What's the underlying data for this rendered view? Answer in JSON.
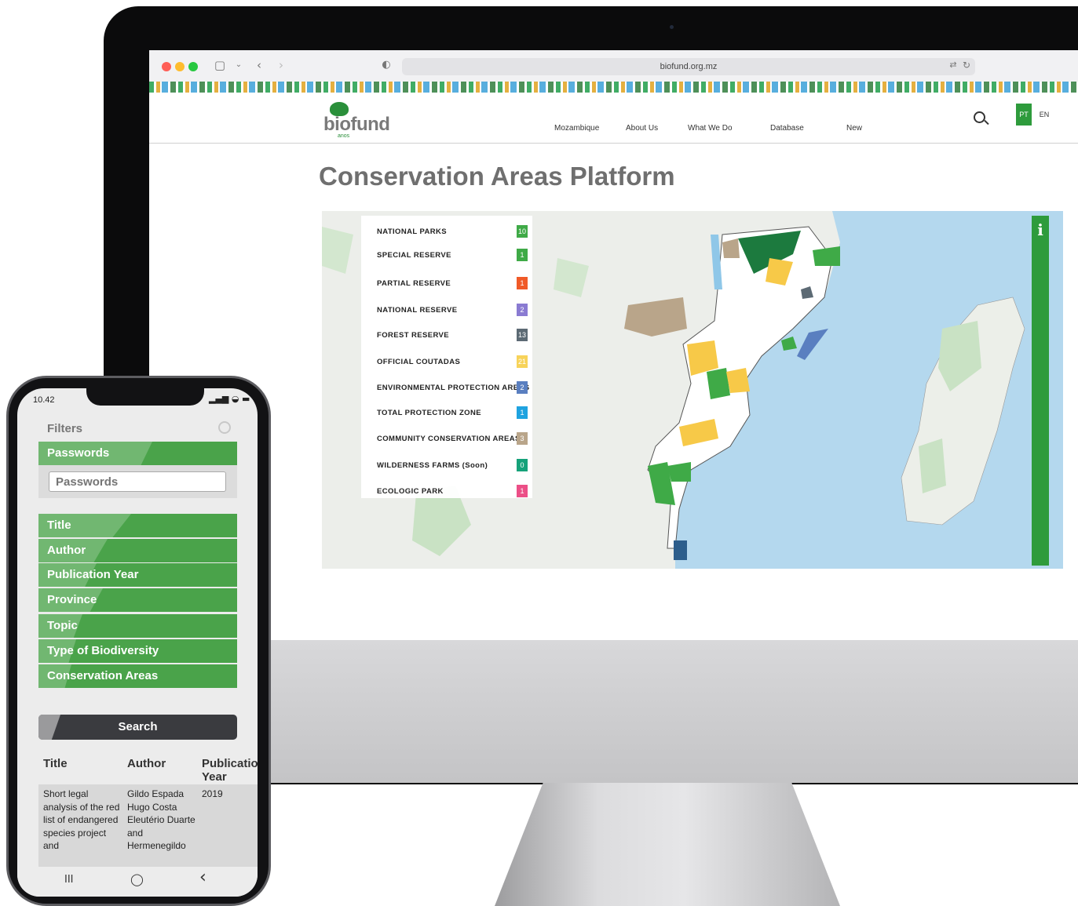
{
  "browser": {
    "url": "biofund.org.mz"
  },
  "site": {
    "logo_text": "biofund",
    "logo_sub": "anos",
    "nav": [
      "Mozambique",
      "About Us",
      "What We Do",
      "Database",
      "New"
    ],
    "lang_pt": "PT",
    "lang_en": "EN"
  },
  "page_title": "Conservation Areas Platform",
  "map": {
    "info_label": "i",
    "legend": [
      {
        "label": "NATIONAL PARKS",
        "count": "10",
        "color": "#3faa47"
      },
      {
        "label": "SPECIAL RESERVE",
        "count": "1",
        "color": "#3faa47"
      },
      {
        "label": "PARTIAL RESERVE",
        "count": "1",
        "color": "#f05a28"
      },
      {
        "label": "NATIONAL RESERVE",
        "count": "2",
        "color": "#8a7bd2"
      },
      {
        "label": "FOREST RESERVE",
        "count": "13",
        "color": "#5c6a74"
      },
      {
        "label": "OFFICIAL COUTADAS",
        "count": "21",
        "color": "#f7d35a"
      },
      {
        "label": "ENVIRONMENTAL PROTECTION AREAS",
        "count": "2",
        "color": "#5a7fc0"
      },
      {
        "label": "TOTAL PROTECTION ZONE",
        "count": "1",
        "color": "#1fa3e0"
      },
      {
        "label": "COMMUNITY CONSERVATION AREAS",
        "count": "3",
        "color": "#b9a58a"
      },
      {
        "label": "WILDERNESS FARMS (Soon)",
        "count": "0",
        "color": "#16a27a"
      },
      {
        "label": "ECOLOGIC PARK",
        "count": "1",
        "color": "#ec4f87"
      }
    ]
  },
  "phone": {
    "time": "10.42",
    "status_icons": "▂▄▆ ◒ ▬",
    "filters_title": "Filters",
    "passwords_label": "Passwords",
    "passwords_placeholder": "Passwords",
    "filters": [
      "Title",
      "Author",
      "Publication Year",
      "Province",
      "Topic",
      "Type of Biodiversity",
      "Conservation Areas"
    ],
    "search_label": "Search",
    "table": {
      "headers": [
        "Title",
        "Author",
        "Publication Year"
      ],
      "rows": [
        {
          "title": "Short legal analysis of the red list of endangered species project and",
          "author": "Gildo Espada Hugo Costa Eleutério Duarte and Hermenegildo",
          "year": "2019"
        }
      ]
    },
    "nav_buttons": [
      "III",
      "◯",
      "‹"
    ]
  },
  "colors": {
    "accent_green": "#2e9b3c",
    "ocean": "#b4d8ee",
    "filter_green": "#4aa34a"
  }
}
